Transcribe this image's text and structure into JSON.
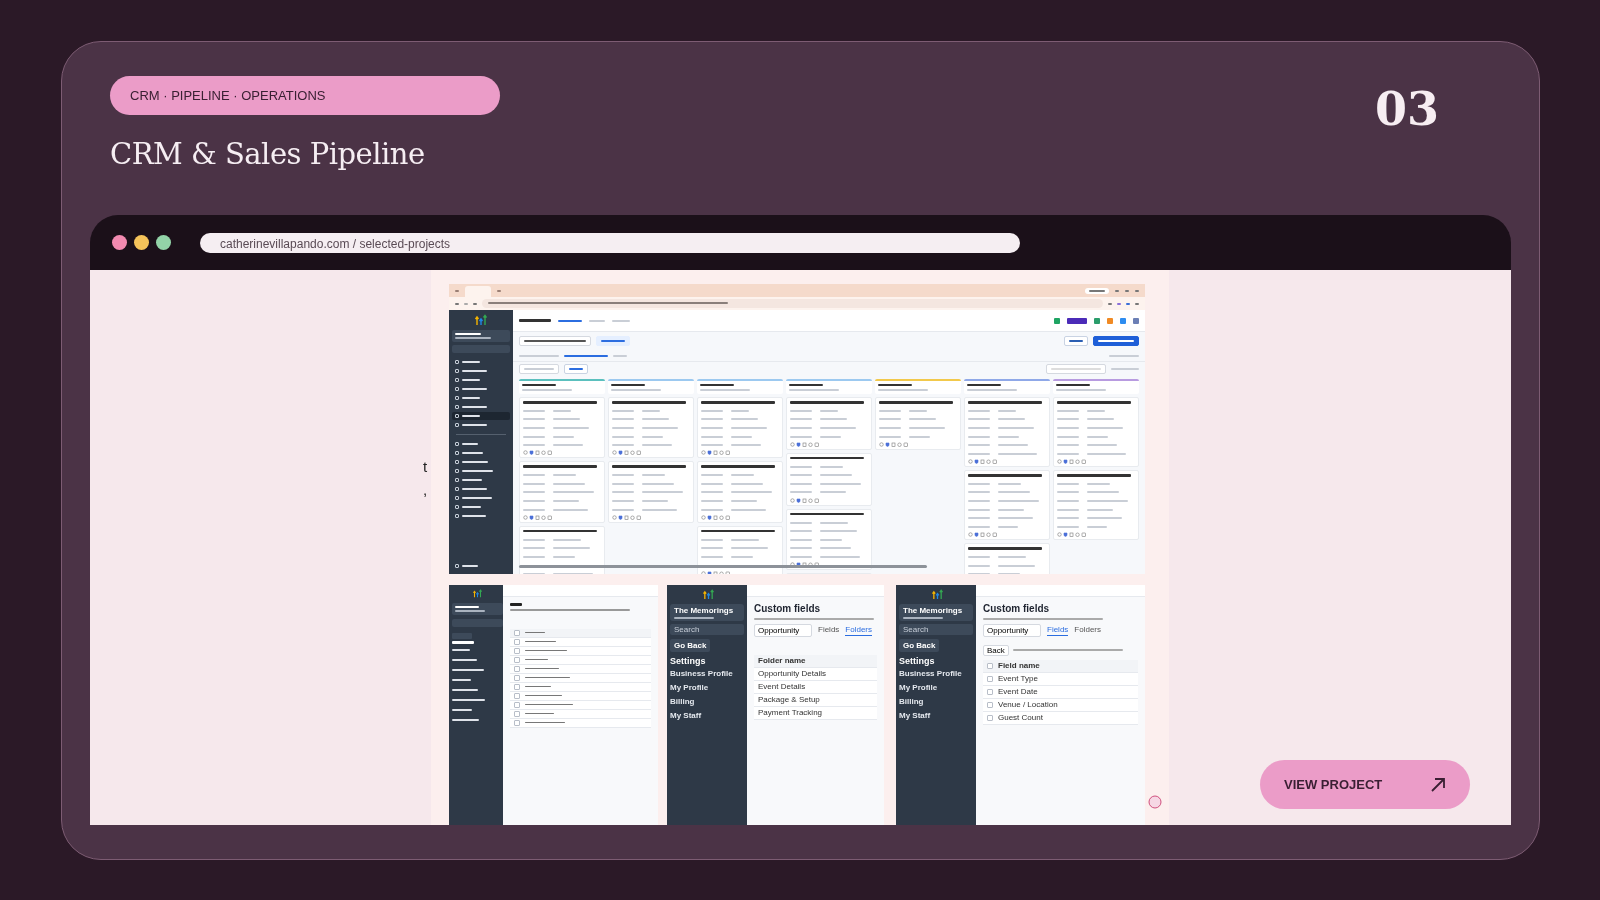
{
  "header": {
    "tag": "CRM · PIPELINE · OPERATIONS",
    "title": "CRM & Sales Pipeline",
    "number": "03"
  },
  "browser": {
    "url": "catherinevillapando.com / selected-projects"
  },
  "background_fragments": [
    "t",
    ","
  ],
  "settings_shots": [
    {
      "kind": "folders",
      "account": "The Memorings",
      "search": "Search",
      "back": "Go Back",
      "heading": "Settings",
      "items": [
        "Business Profile",
        "My Profile",
        "Billing",
        "My Staff"
      ],
      "title": "Custom fields",
      "object": "Opportunity",
      "tabs": [
        {
          "label": "Fields",
          "selected": false
        },
        {
          "label": "Folders",
          "selected": true
        }
      ],
      "column": "Folder name",
      "rows": [
        {
          "label": "Opportunity Details"
        },
        {
          "label": "Event Details"
        },
        {
          "label": "Package & Setup"
        },
        {
          "label": "Payment Tracking"
        }
      ]
    },
    {
      "kind": "fields",
      "account": "The Memorings",
      "search": "Search",
      "back": "Go Back",
      "heading": "Settings",
      "items": [
        "Business Profile",
        "My Profile",
        "Billing",
        "My Staff"
      ],
      "title": "Custom fields",
      "object": "Opportunity",
      "tabs": [
        {
          "label": "Fields",
          "selected": true
        },
        {
          "label": "Folders",
          "selected": false
        }
      ],
      "back_button": "Back",
      "column": "Field name",
      "header_checked": false,
      "rows": [
        {
          "label": "Event Type",
          "checked": false
        },
        {
          "label": "Event Date",
          "checked": false
        },
        {
          "label": "Venue / Location",
          "checked": false
        },
        {
          "label": "Guest Count",
          "checked": false
        }
      ]
    }
  ],
  "cta": "VIEW PROJECT"
}
